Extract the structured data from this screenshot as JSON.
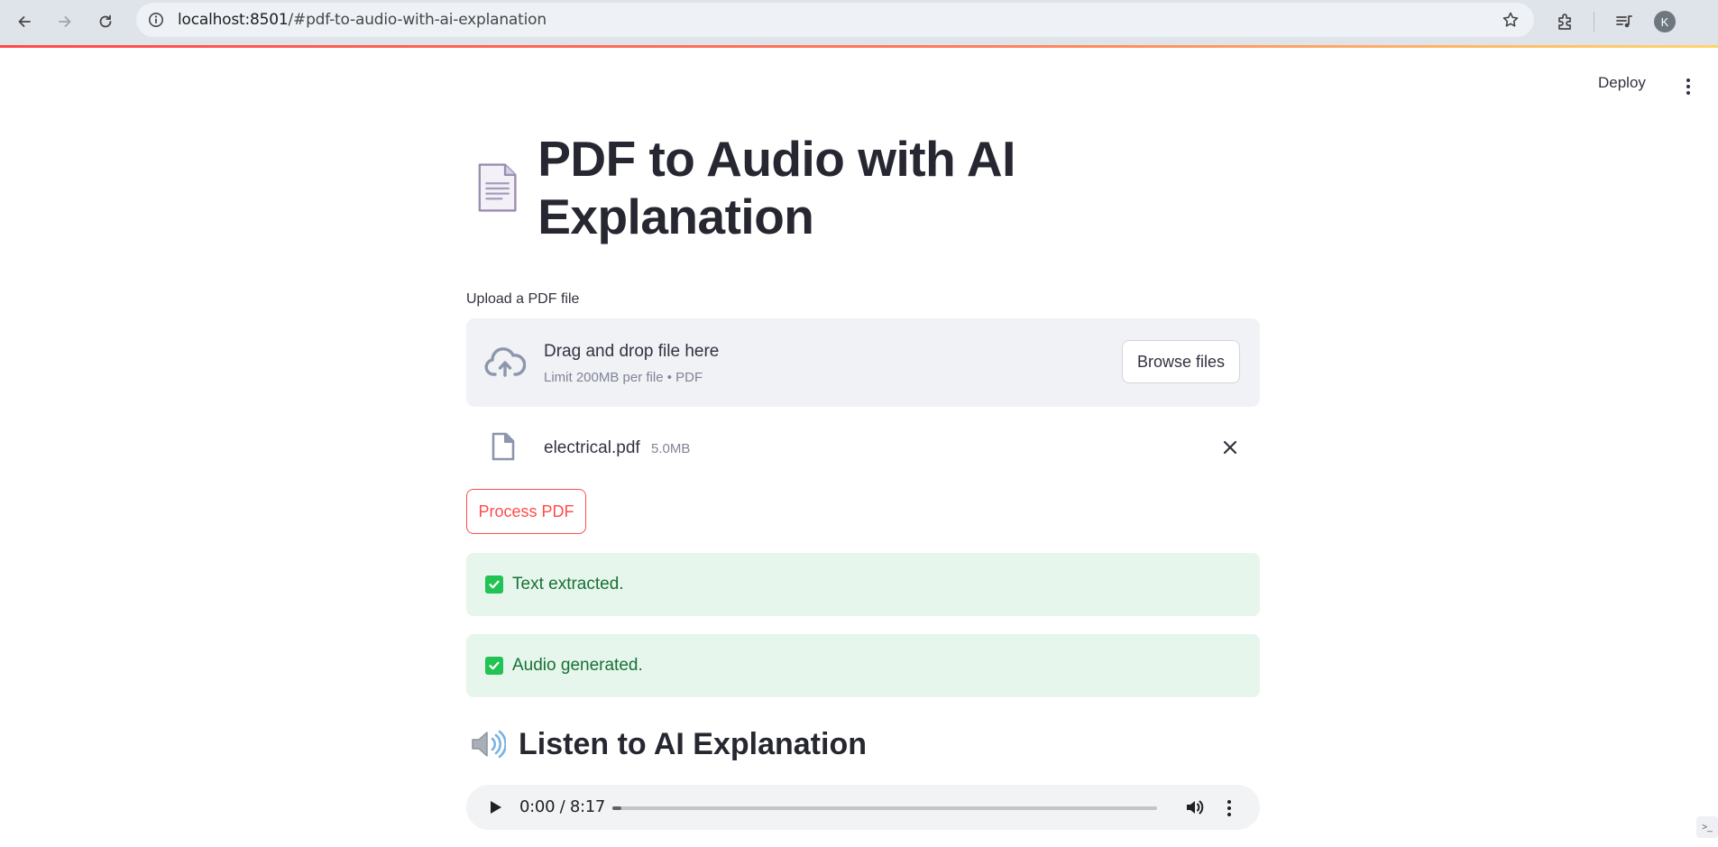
{
  "browser": {
    "url_host": "localhost:8501",
    "url_path": "/#pdf-to-audio-with-ai-explanation",
    "profile_initial": "K"
  },
  "header": {
    "deploy_label": "Deploy"
  },
  "page": {
    "title": "PDF to Audio with AI Explanation",
    "title_icon": "page-facing-up-emoji"
  },
  "uploader": {
    "label": "Upload a PDF file",
    "drop_title": "Drag and drop file here",
    "drop_subtitle": "Limit 200MB per file • PDF",
    "browse_label": "Browse files",
    "file": {
      "name": "electrical.pdf",
      "size": "5.0MB"
    }
  },
  "actions": {
    "process_label": "Process PDF"
  },
  "alerts": [
    {
      "text": "Text extracted."
    },
    {
      "text": "Audio generated."
    }
  ],
  "section": {
    "title": "Listen to AI Explanation",
    "icon": "speaker-high-volume-emoji"
  },
  "audio": {
    "time_display": "0:00 / 8:17",
    "current": "0:00",
    "duration": "8:17",
    "progress_fraction": 0
  },
  "colors": {
    "primary": "#ff4b4b",
    "success_bg": "#e6f6ec",
    "success_text": "#177233",
    "dropzone_bg": "#f0f2f6"
  }
}
